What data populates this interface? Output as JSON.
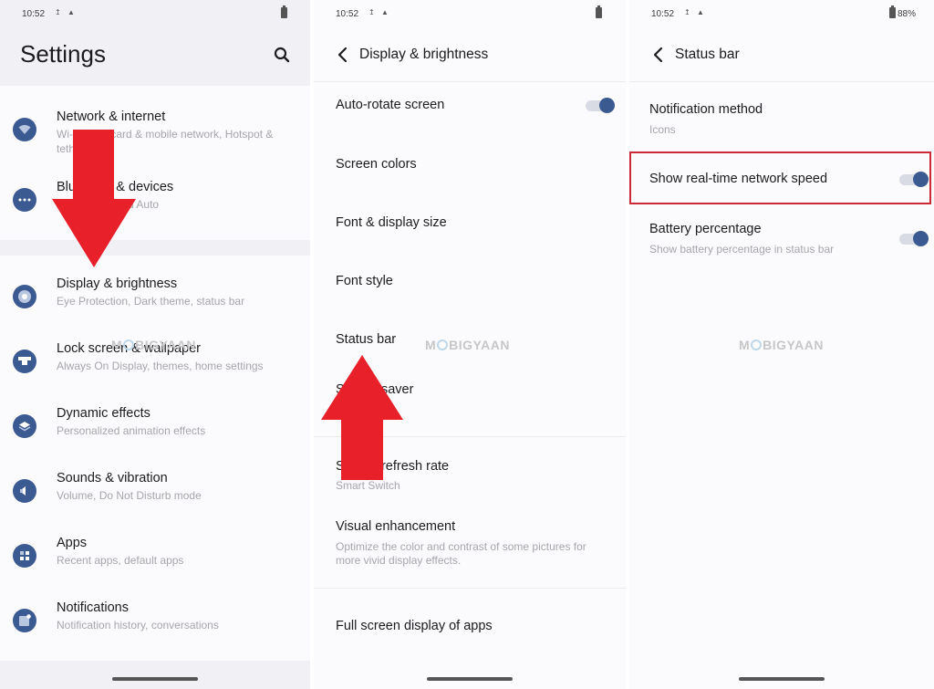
{
  "status": {
    "time": "10:52",
    "battery_pct_panel3": "88%"
  },
  "watermark": {
    "pre": "M",
    "post": "BIGYAAN"
  },
  "panel1": {
    "title": "Settings",
    "search_icon": "search-icon",
    "items": [
      {
        "label": "Network & internet",
        "sub": "Wi-Fi, SIM card & mobile network, Hotspot & tethering",
        "icon": "wifi-icon"
      },
      {
        "label": "Bluetooth & devices",
        "sub": "Pairing, Android Auto",
        "icon": "more-dots-icon"
      },
      {
        "label": "Display & brightness",
        "sub": "Eye Protection, Dark theme, status bar",
        "icon": "display-icon"
      },
      {
        "label": "Lock screen & wallpaper",
        "sub": "Always On Display, themes, home settings",
        "icon": "lock-screen-icon"
      },
      {
        "label": "Dynamic effects",
        "sub": "Personalized animation effects",
        "icon": "layers-icon"
      },
      {
        "label": "Sounds & vibration",
        "sub": "Volume, Do Not Disturb mode",
        "icon": "speaker-icon"
      },
      {
        "label": "Apps",
        "sub": "Recent apps, default apps",
        "icon": "apps-grid-icon"
      },
      {
        "label": "Notifications",
        "sub": "Notification history, conversations",
        "icon": "notification-icon"
      }
    ]
  },
  "panel2": {
    "title": "Display & brightness",
    "rows": [
      {
        "label": "Auto-rotate screen",
        "toggle": true
      },
      {
        "label": "Screen colors"
      },
      {
        "label": "Font & display size"
      },
      {
        "label": "Font style"
      },
      {
        "label": "Status bar"
      },
      {
        "label": "Screen saver"
      },
      {
        "label": "Screen refresh rate",
        "sub": "Smart Switch"
      },
      {
        "label": "Visual enhancement",
        "sub": "Optimize the color and contrast of some pictures for more vivid display effects."
      },
      {
        "label": "Full screen display of apps"
      }
    ]
  },
  "panel3": {
    "title": "Status bar",
    "rows": [
      {
        "label": "Notification method",
        "sub": "Icons"
      },
      {
        "label": "Show real-time network speed",
        "toggle": true
      },
      {
        "label": "Battery percentage",
        "sub": "Show battery percentage in status bar",
        "toggle": true
      }
    ]
  },
  "colors": {
    "accent": "#3c5a92",
    "arrow": "#e8202a",
    "highlight": "#cc2a36"
  }
}
